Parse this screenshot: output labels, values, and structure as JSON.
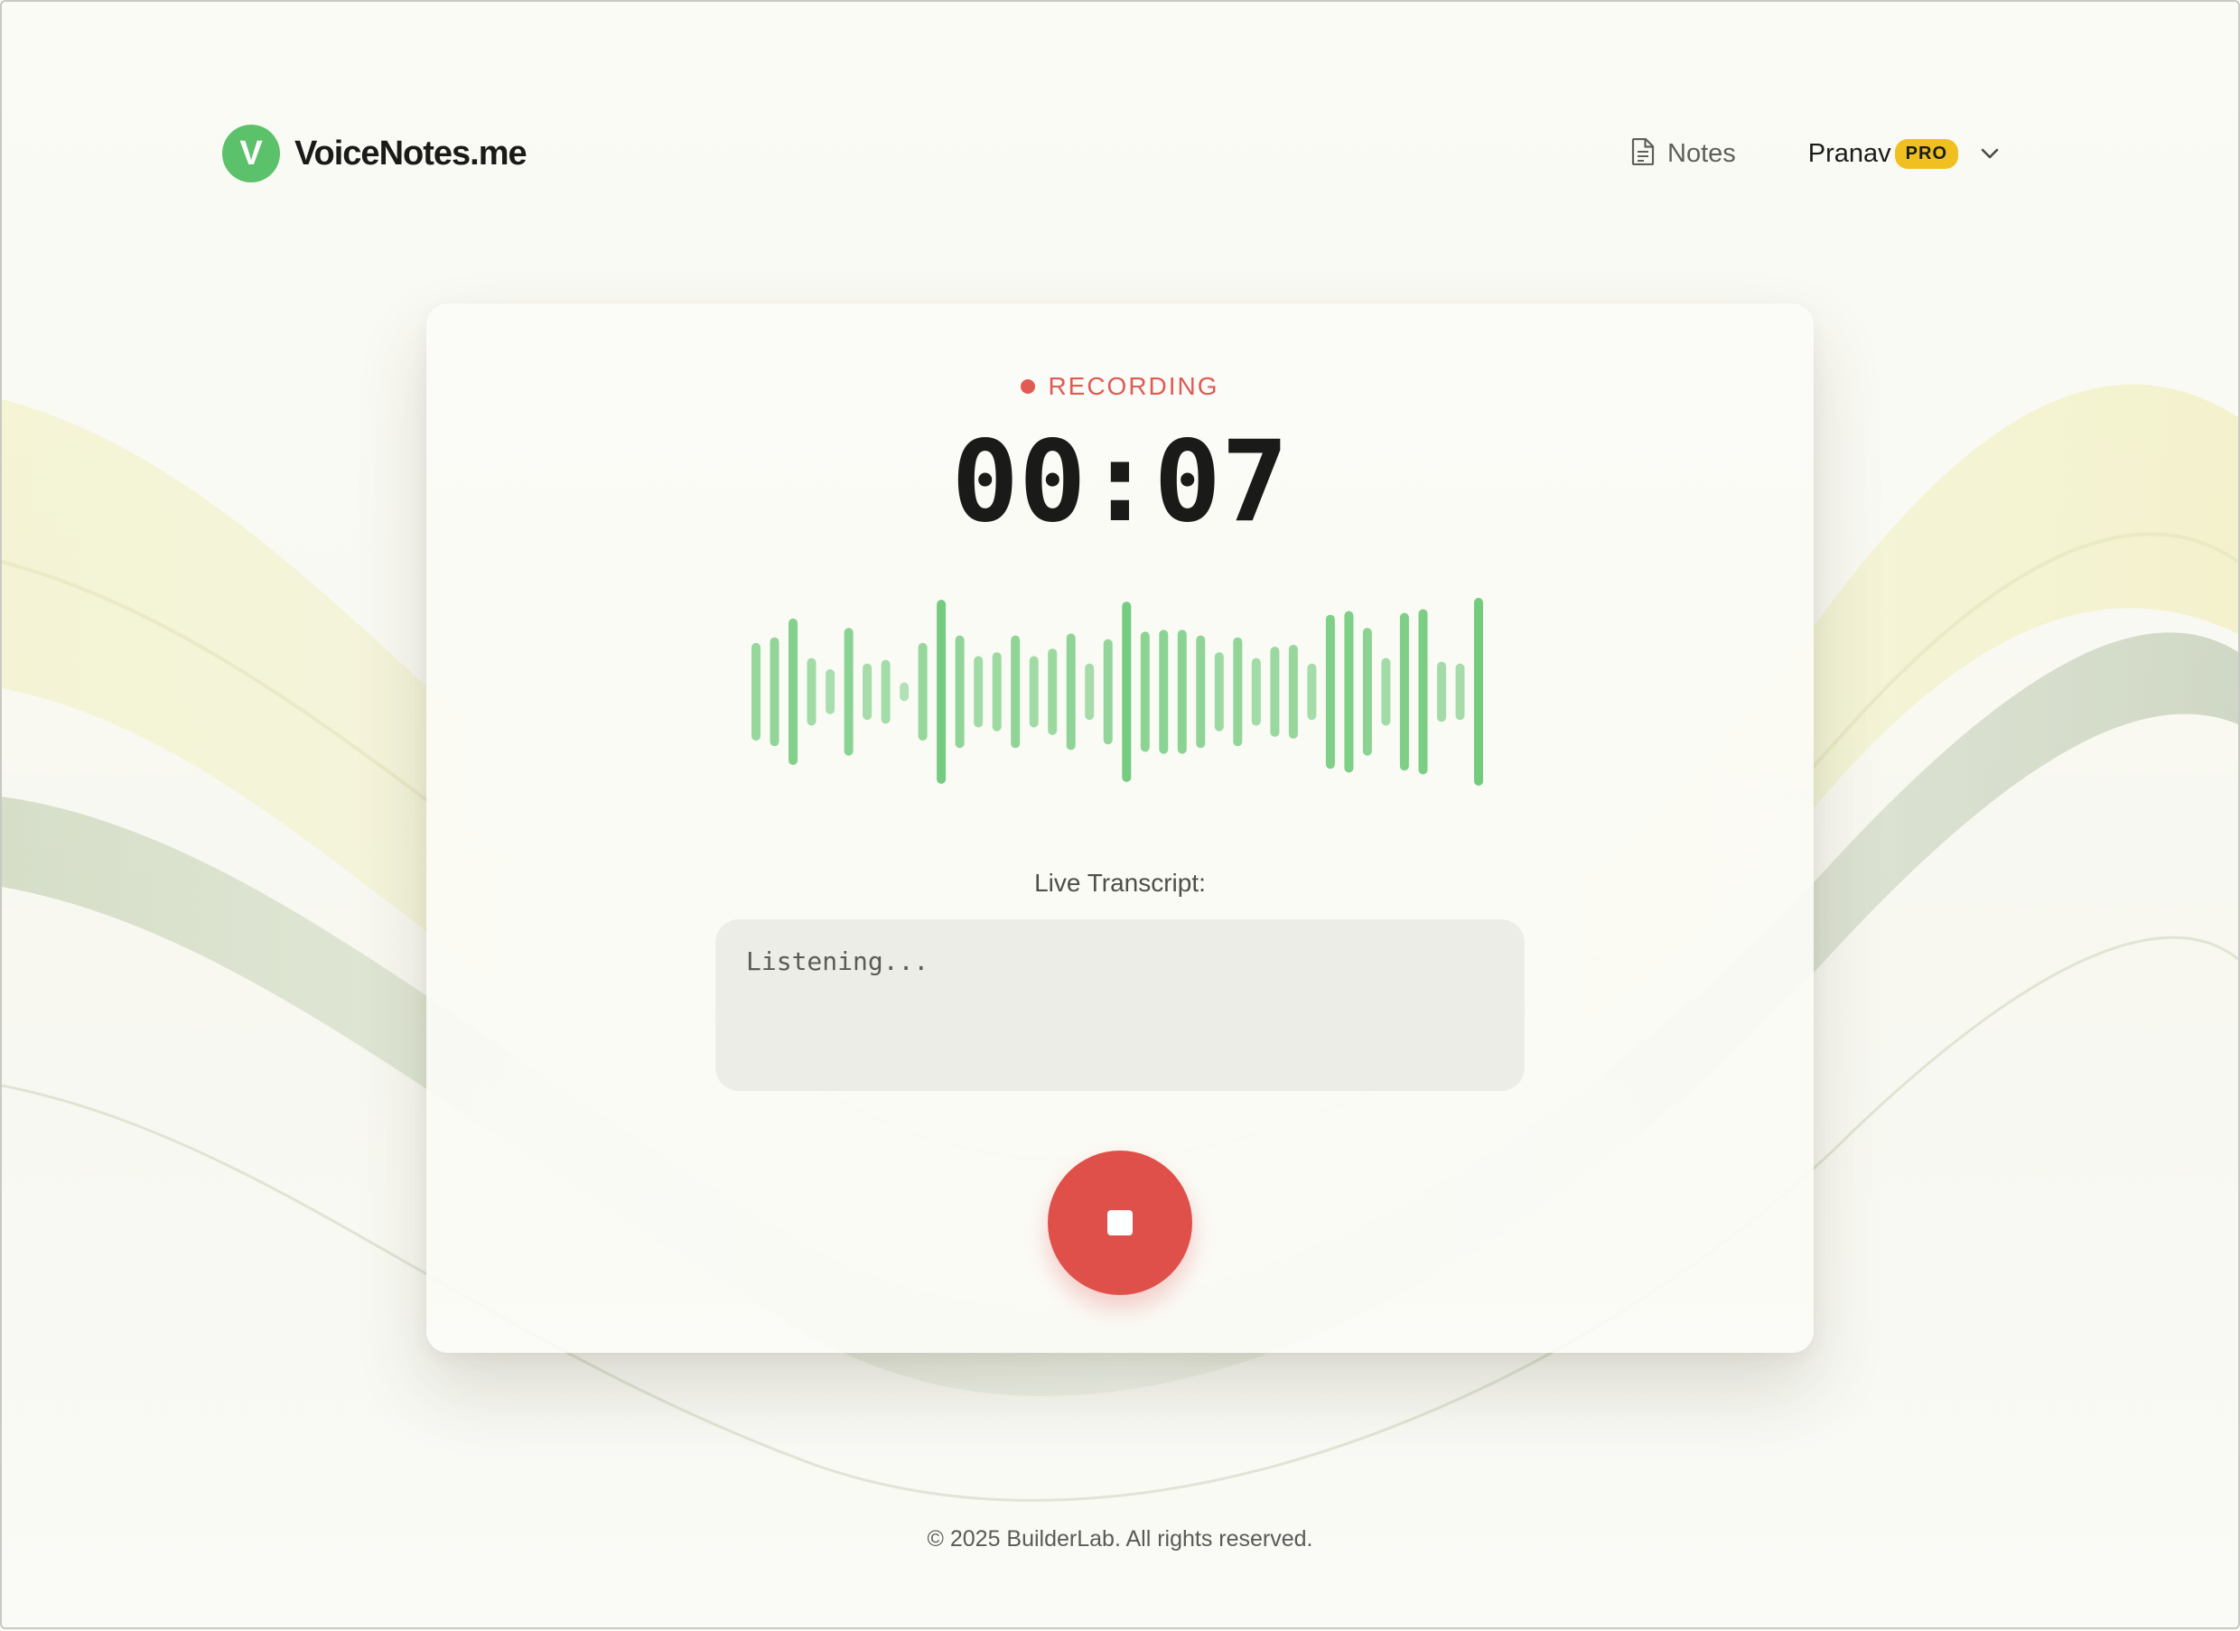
{
  "app": {
    "logo_letter": "V",
    "name": "VoiceNotes.me",
    "brand_color": "#5cc16b"
  },
  "nav": {
    "notes_label": "Notes",
    "notes_icon": "document-icon",
    "user_name": "Pranav",
    "plan_badge": "PRO",
    "menu_icon": "chevron-down-icon"
  },
  "recorder": {
    "status": "RECORDING",
    "status_color": "#e35a54",
    "timer": "00:07",
    "waveform_levels": [
      0.52,
      0.58,
      0.78,
      0.36,
      0.24,
      0.68,
      0.3,
      0.34,
      0.1,
      0.52,
      0.98,
      0.6,
      0.38,
      0.42,
      0.6,
      0.38,
      0.46,
      0.62,
      0.3,
      0.56,
      0.96,
      0.64,
      0.66,
      0.66,
      0.6,
      0.42,
      0.58,
      0.36,
      0.48,
      0.5,
      0.3,
      0.82,
      0.86,
      0.68,
      0.36,
      0.84,
      0.88,
      0.32,
      0.3,
      1.0
    ],
    "waveform_color": "#6cc877",
    "transcript_label": "Live Transcript:",
    "transcript_text": "Listening...",
    "stop_icon": "stop-icon",
    "stop_color": "#e0504b"
  },
  "footer": {
    "copyright": "© 2025 BuilderLab. All rights reserved."
  }
}
